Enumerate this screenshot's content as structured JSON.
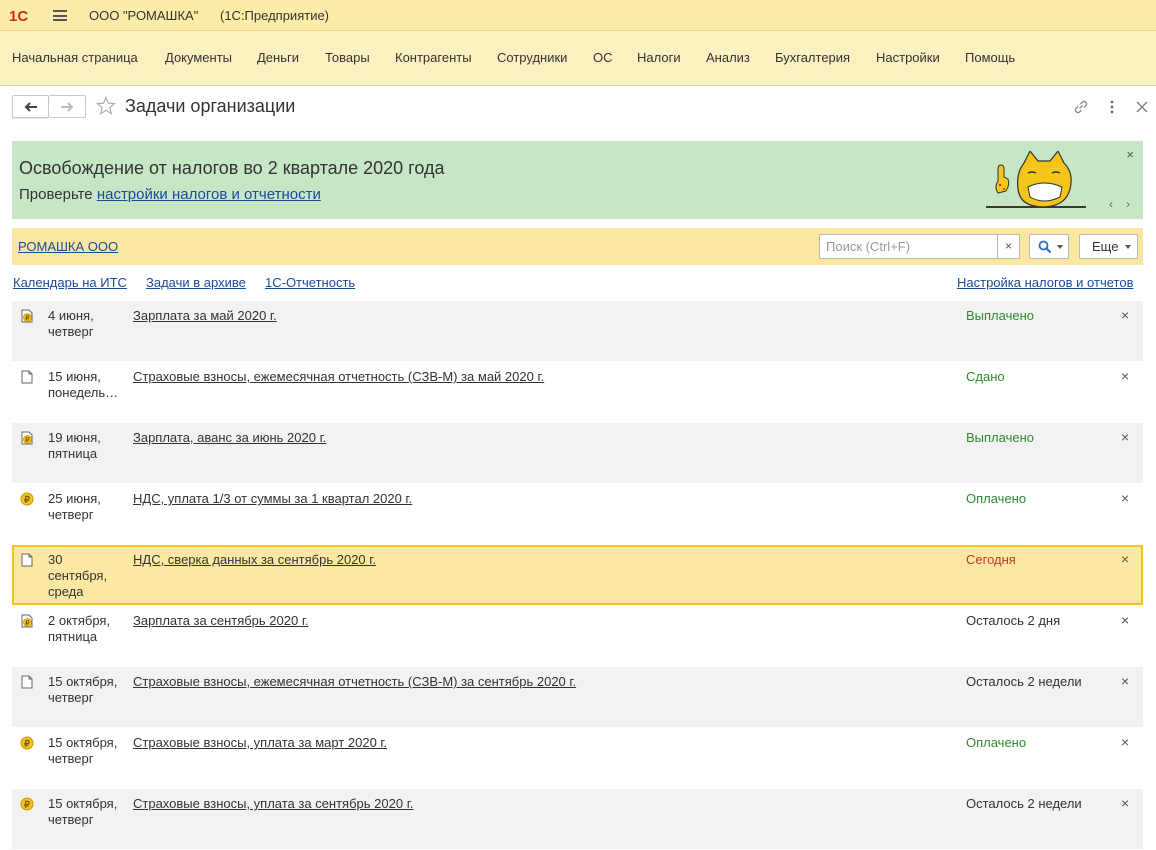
{
  "titlebar": {
    "logo_text": "1С",
    "app_name": "ООО \"РОМАШКА\"",
    "app_sub": "(1С:Предприятие)"
  },
  "nav": {
    "items": [
      {
        "label": "Начальная страница"
      },
      {
        "label": "Документы"
      },
      {
        "label": "Деньги"
      },
      {
        "label": "Товары"
      },
      {
        "label": "Контрагенты"
      },
      {
        "label": "Сотрудники"
      },
      {
        "label": "ОС"
      },
      {
        "label": "Налоги"
      },
      {
        "label": "Анализ"
      },
      {
        "label": "Бухгалтерия"
      },
      {
        "label": "Настройки"
      },
      {
        "label": "Помощь"
      }
    ]
  },
  "header": {
    "title": "Задачи организации"
  },
  "banner": {
    "title": "Освобождение от налогов во 2 квартале 2020 года",
    "sub_text": "Проверьте ",
    "sub_link": "настройки налогов и отчетности",
    "close": "×",
    "prev": "‹",
    "next": "›"
  },
  "filter": {
    "org_link": "РОМАШКА ООО",
    "search_placeholder": "Поиск (Ctrl+F)",
    "search_clear": "×",
    "more_label": "Еще"
  },
  "links": {
    "calendar": "Календарь на ИТС",
    "archive": "Задачи в архиве",
    "reporting": "1С-Отчетность",
    "settings": "Настройка налогов и отчетов"
  },
  "tasks": [
    {
      "icon": "coin-document-icon",
      "date_line1": "4 июня,",
      "date_line2": "четверг",
      "date_line3": "",
      "title": "Зарплата за май 2020 г.",
      "status": "Выплачено",
      "status_color": "#2e8b2e",
      "close": "×"
    },
    {
      "icon": "document-icon",
      "date_line1": "15 июня,",
      "date_line2": "понедель…",
      "date_line3": "",
      "title": "Страховые взносы, ежемесячная отчетность (СЗВ-М) за май 2020 г.",
      "status": "Сдано",
      "status_color": "#2e8b2e",
      "close": "×"
    },
    {
      "icon": "coin-document-icon",
      "date_line1": "19 июня,",
      "date_line2": "пятница",
      "date_line3": "",
      "title": "Зарплата, аванс за июнь 2020 г.",
      "status": "Выплачено",
      "status_color": "#2e8b2e",
      "close": "×"
    },
    {
      "icon": "coin-icon",
      "date_line1": "25 июня,",
      "date_line2": "четверг",
      "date_line3": "",
      "title": "НДС, уплата 1/3 от суммы за 1 квартал 2020 г.",
      "status": "Оплачено",
      "status_color": "#2e8b2e",
      "close": "×"
    },
    {
      "icon": "document-icon",
      "date_line1": "30",
      "date_line2": "сентября,",
      "date_line3": "среда",
      "title": "НДС, сверка данных за сентябрь 2020 г.",
      "status": "Сегодня",
      "status_color": "#c0392b",
      "close": "×"
    },
    {
      "icon": "coin-document-icon",
      "date_line1": "2 октября,",
      "date_line2": "пятница",
      "date_line3": "",
      "title": "Зарплата за сентябрь 2020 г.",
      "status": "Осталось 2 дня",
      "status_color": "#333333",
      "close": "×"
    },
    {
      "icon": "document-icon",
      "date_line1": "15 октября,",
      "date_line2": "четверг",
      "date_line3": "",
      "title": "Страховые взносы, ежемесячная отчетность (СЗВ-М) за сентябрь 2020 г.",
      "status": "Осталось 2 недели",
      "status_color": "#333333",
      "close": "×"
    },
    {
      "icon": "coin-icon",
      "date_line1": "15 октября,",
      "date_line2": "четверг",
      "date_line3": "",
      "title": "Страховые взносы, уплата за март 2020 г.",
      "status": "Оплачено",
      "status_color": "#2e8b2e",
      "close": "×"
    },
    {
      "icon": "coin-icon",
      "date_line1": "15 октября,",
      "date_line2": "четверг",
      "date_line3": "",
      "title": "Страховые взносы, уплата за сентябрь 2020 г.",
      "status": "Осталось 2 недели",
      "status_color": "#333333",
      "close": "×"
    }
  ],
  "colors": {
    "accent_yellow": "#fbeda8",
    "banner_green": "#c6e6c6",
    "link_blue": "#1a4a9c",
    "status_green": "#2e8b2e",
    "status_red": "#c0392b",
    "highlight_border": "#f0c419"
  }
}
